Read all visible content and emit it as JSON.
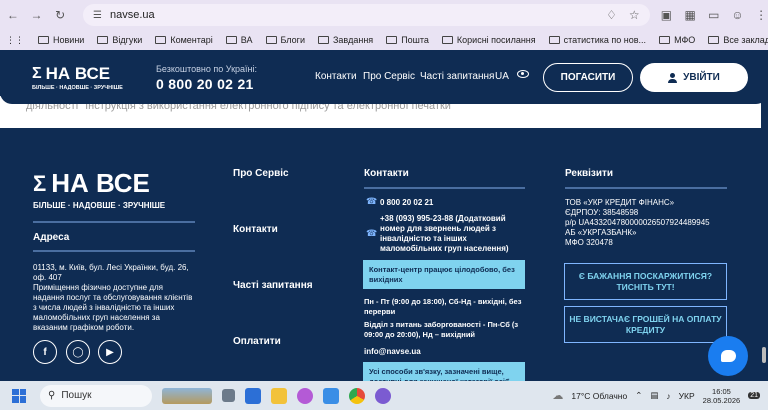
{
  "browser": {
    "url": "navse.ua",
    "bookmarks": [
      "Новини",
      "Відгуки",
      "Коментарі",
      "ВА",
      "Блоги",
      "Завдання",
      "Пошта",
      "Корисні посилання",
      "статистика по нов...",
      "МФО"
    ],
    "all_bookmarks": "Все закладки"
  },
  "header": {
    "logo_text": "НА ВСЕ",
    "logo_sub": "БІЛЬШЕ · НАДОВШЕ · ЗРУЧНІШЕ",
    "free_label": "Безкоштовно по Україні:",
    "phone": "0 800 20 02 21",
    "nav": [
      "Контакти",
      "Про Сервіс",
      "Часті запитання",
      "UA"
    ],
    "repay_button": "ПОГАСИТИ",
    "login_button": "УВІЙТИ"
  },
  "strip_text": "діяльності\" Інструкція з використання електронного підпису та електронної печатки",
  "footer": {
    "logo_text": "НА ВСЕ",
    "logo_sub": "БІЛЬШЕ · НАДОВШЕ · ЗРУЧНІШЕ",
    "address_title": "Адреса",
    "address": "01133, м. Київ, бул. Лесі Українки, буд. 26, оф. 407",
    "address_note": "Приміщення фізично доступне для надання послуг та обслуговування клієнтів з числа людей з інвалідністю та інших маломобільних груп населення за вказаним графіком роботи.",
    "links": [
      "Про Сервіс",
      "Контакти",
      "Часті запитання",
      "Оплатити"
    ],
    "contacts_title": "Контакти",
    "phone1": "0 800 20 02 21",
    "phone2": "+38 (093) 995-23-88 (Додатковий номер для звернень людей з інвалідністю та інших маломобільних груп населення)",
    "box1": "Контакт-центр працює цілодобово, без вихідних",
    "schedule": "Пн - Пт (9:00 до 18:00), Сб-Нд - вихідні, без перерви",
    "debt_dept": "Відділ з питань заборгованості - Пн-Сб (з 09:00 до 20:00), Нд – вихідний",
    "email": "info@navse.ua",
    "box2": "Усі способи зв'язку, зазначені вище, доступні для захищеної категорії осіб та",
    "requisites_title": "Реквізити",
    "requisites": [
      "ТОВ «УКР КРЕДИТ ФІНАНС»",
      "ЄДРПОУ: 38548598",
      "р/р UA433204780000026507924489945",
      "АБ «УКРГАЗБАНК»",
      "МФО 320478"
    ],
    "complaint_button": "Є БАЖАННЯ ПОСКАРЖИТИСЯ? ТИСНІТЬ ТУТ!",
    "money_button": "НЕ ВИСТАЧАЄ ГРОШЕЙ НА ОПЛАТУ КРЕДИТУ"
  },
  "taskbar": {
    "search": "Пошук",
    "weather": "17°C Облачно",
    "lang": "УКР",
    "time": "16:05",
    "date": "28.05.2026",
    "notif": "21"
  }
}
